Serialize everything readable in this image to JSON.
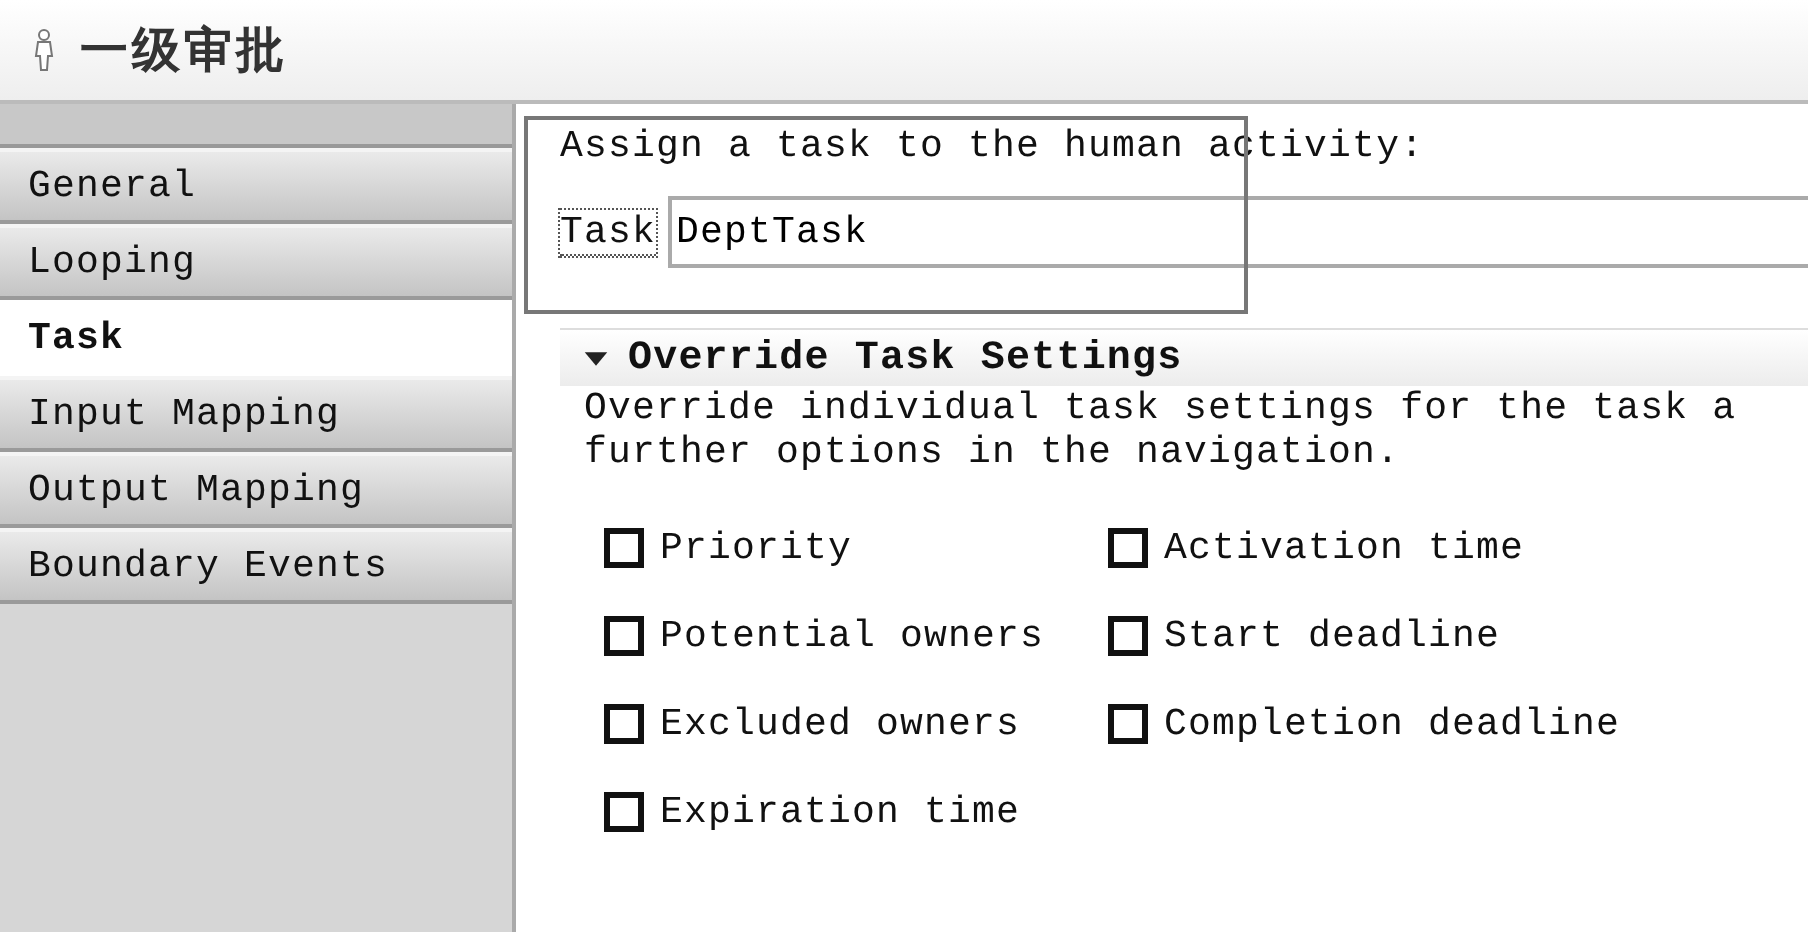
{
  "header": {
    "title": "一级审批"
  },
  "tabs": [
    {
      "label": "General",
      "selected": false
    },
    {
      "label": "Looping",
      "selected": false
    },
    {
      "label": "Task",
      "selected": true
    },
    {
      "label": "Input Mapping",
      "selected": false
    },
    {
      "label": "Output Mapping",
      "selected": false
    },
    {
      "label": "Boundary Events",
      "selected": false
    }
  ],
  "assign": {
    "prompt": "Assign a task to the human activity:",
    "link": "Task",
    "value": "DeptTask"
  },
  "section": {
    "title": "Override Task Settings",
    "expanded": true,
    "description_lines": [
      "Override individual task settings for the task a",
      "further options in the navigation."
    ]
  },
  "options": [
    {
      "label": "Priority",
      "checked": false
    },
    {
      "label": "Activation time",
      "checked": false
    },
    {
      "label": "Potential owners",
      "checked": false
    },
    {
      "label": "Start deadline",
      "checked": false
    },
    {
      "label": "Excluded owners",
      "checked": false
    },
    {
      "label": "Completion deadline",
      "checked": false
    },
    {
      "label": "Expiration time",
      "checked": false
    }
  ]
}
